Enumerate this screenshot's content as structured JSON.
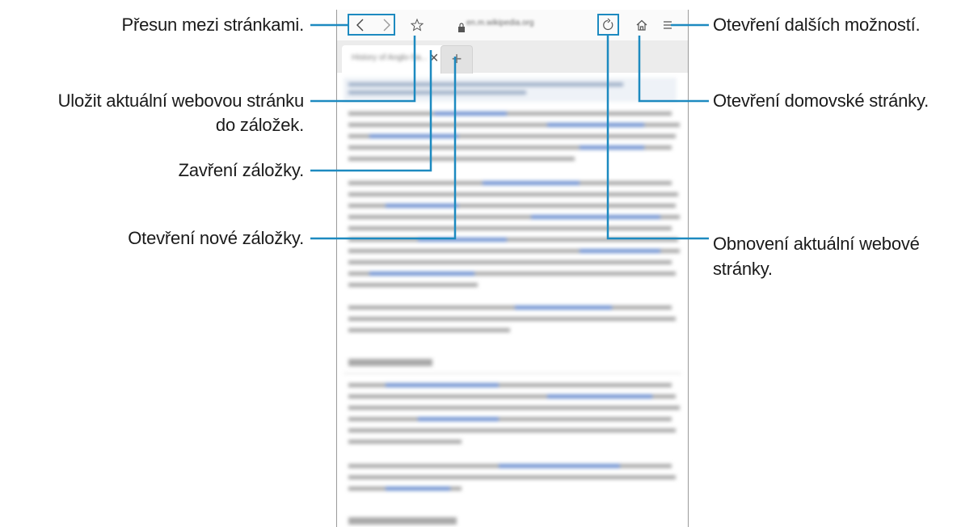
{
  "callouts": {
    "navigation": "Přesun mezi stránkami.",
    "bookmark_line1": "Uložit aktuální webovou stránku",
    "bookmark_line2": "do záložek.",
    "close_tab": "Zavření záložky.",
    "new_tab": "Otevření nové záložky.",
    "more_options": "Otevření dalších možností.",
    "home": "Otevření domovské stránky.",
    "refresh_line1": "Obnovení aktuální webové",
    "refresh_line2": "stránky."
  },
  "browser": {
    "url": "en.m.wikipedia.org",
    "tab_title": "History of Anglo-Sa...",
    "icons": {
      "back": "chevron-left-icon",
      "forward": "chevron-right-icon",
      "bookmark": "star-icon",
      "lock": "lock-icon",
      "refresh": "refresh-icon",
      "home": "home-icon",
      "menu": "menu-icon",
      "close_tab": "close-icon",
      "new_tab": "plus-icon"
    }
  },
  "colors": {
    "callout": "#1d8ac0",
    "link_text": "#2f6fc4"
  }
}
